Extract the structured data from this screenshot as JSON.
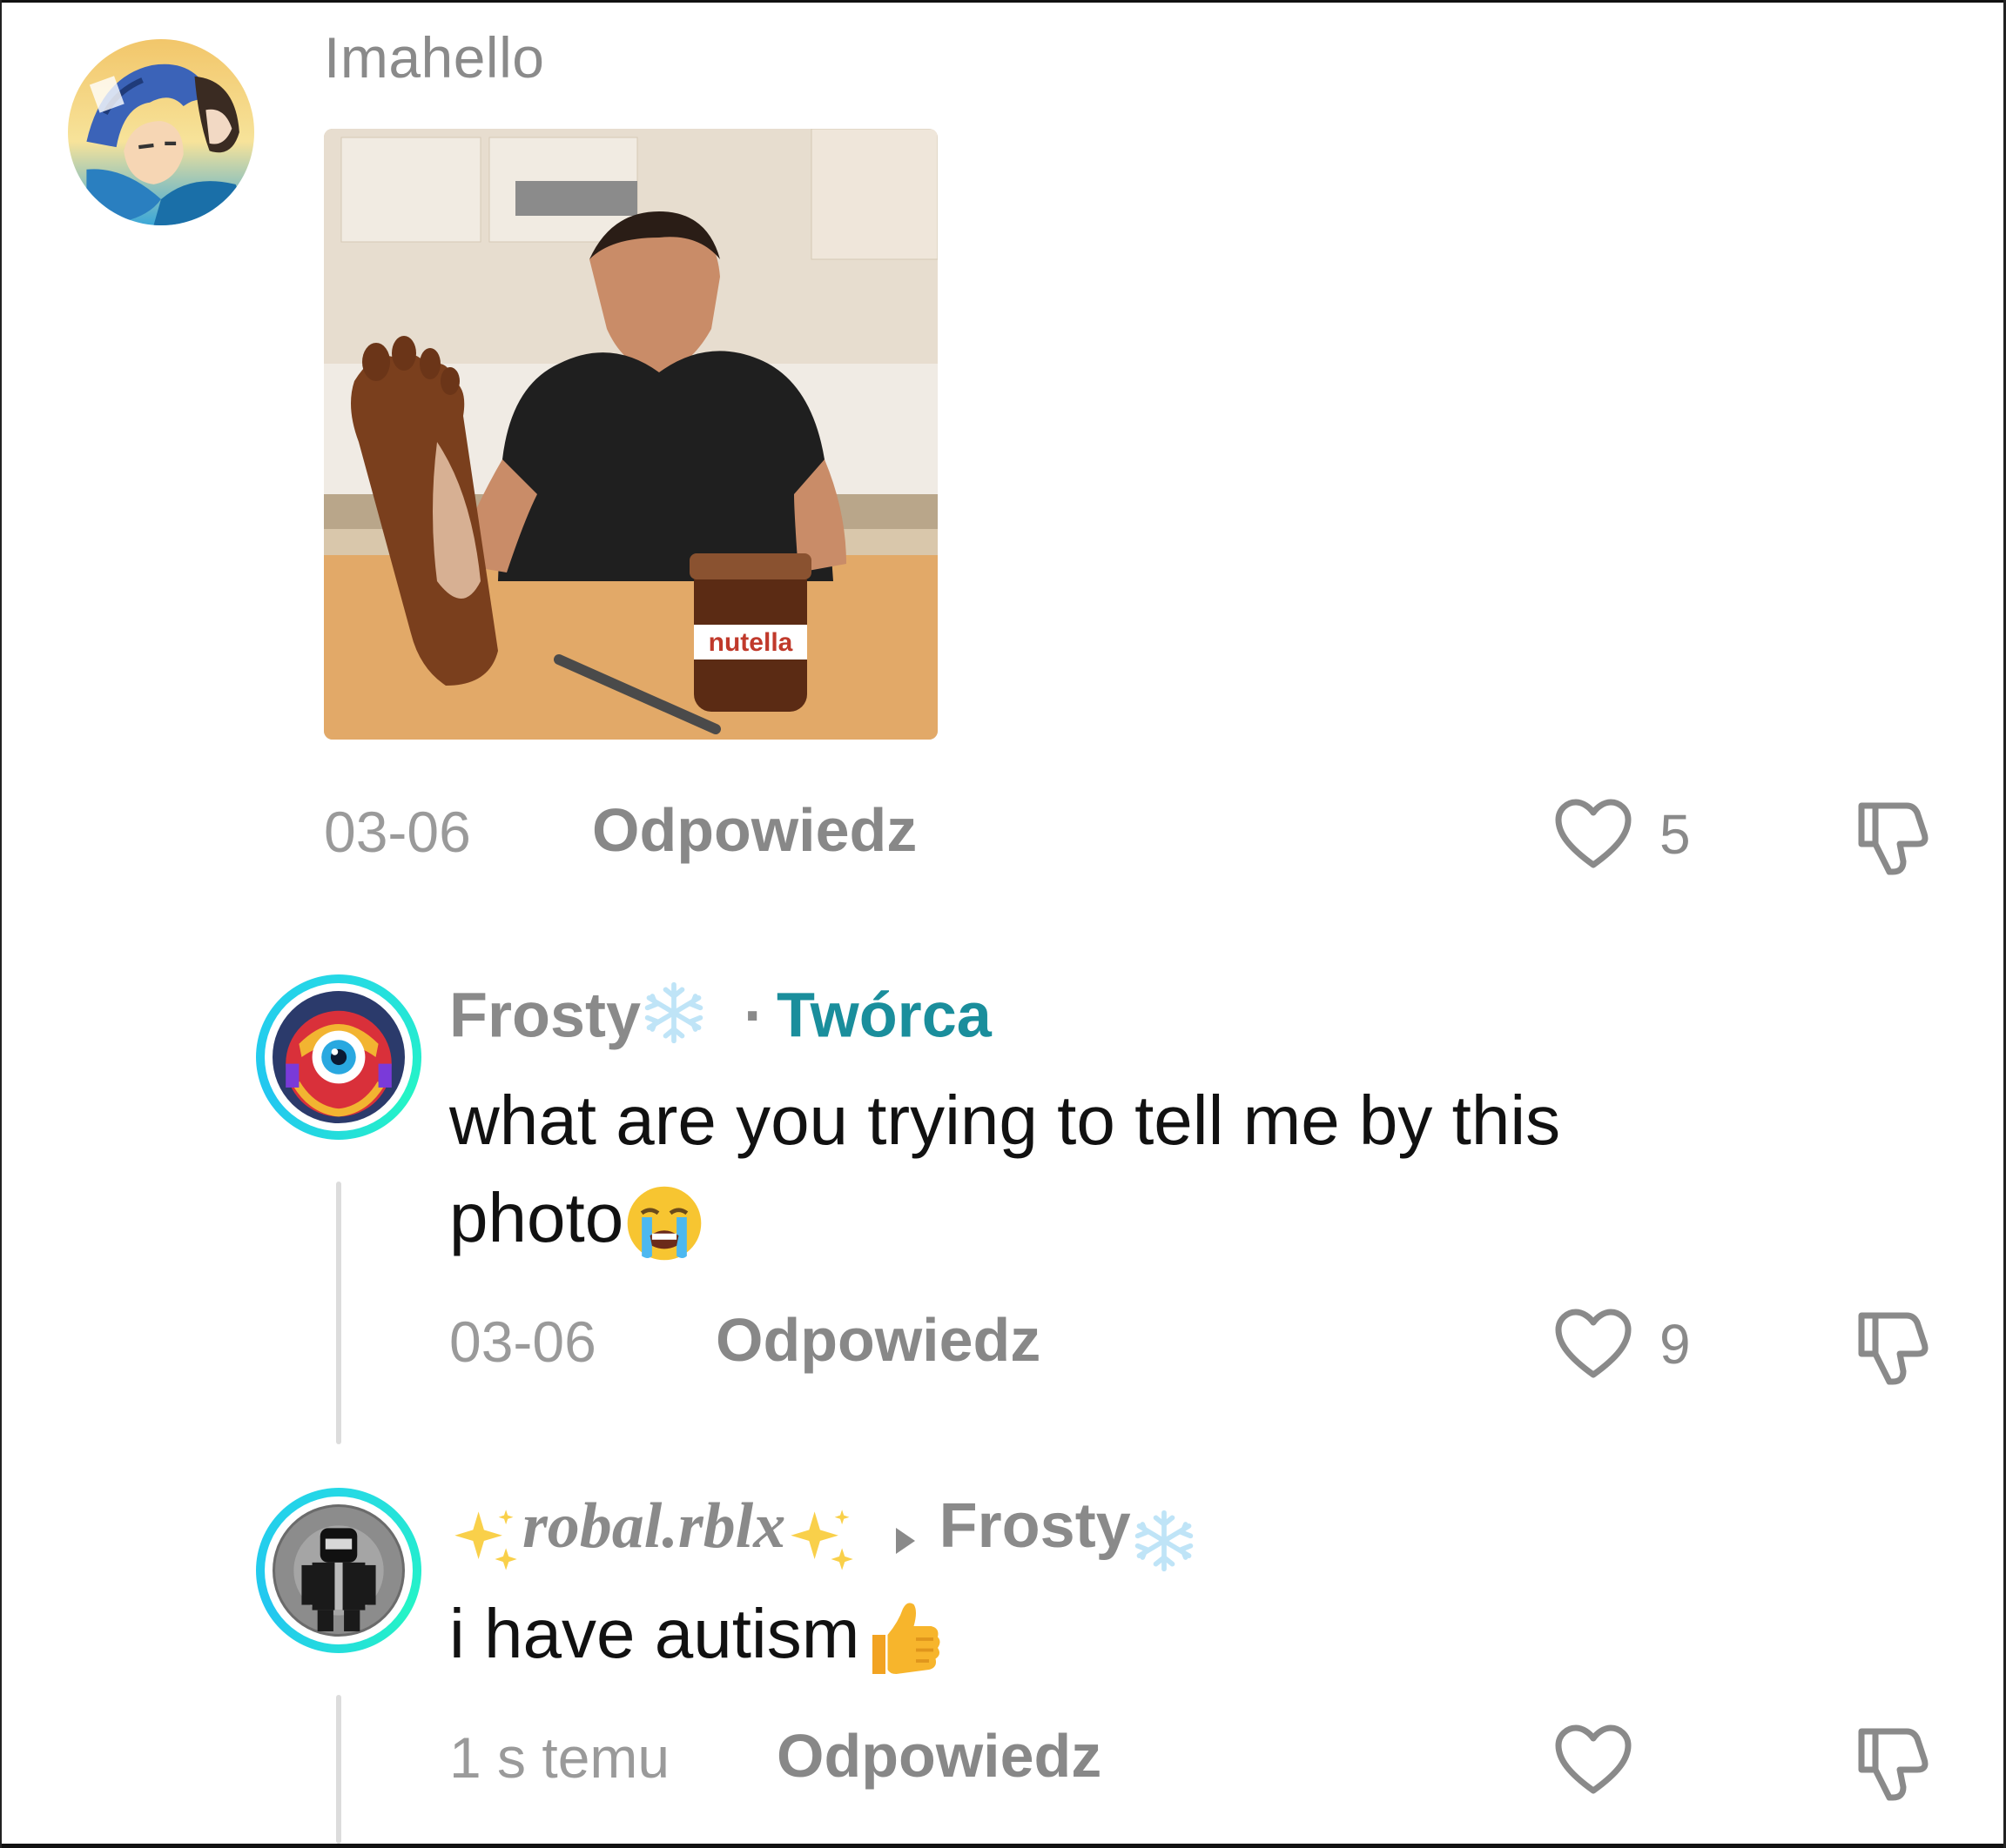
{
  "comments": [
    {
      "username": "Imahello",
      "image_alt": "",
      "date": "03-06",
      "reply_label": "Odpowiedz",
      "likes": "5",
      "avatar": "anime-character-avatar"
    },
    {
      "username": "Frosty",
      "username_suffix_icon": "snowflake-icon",
      "separator": "·",
      "role_tag": "Twórca",
      "text_line1": "what are you trying to tell me by this",
      "text_line2": "photo",
      "text_emoji": "loudly-crying-face",
      "date": "03-06",
      "reply_label": "Odpowiedz",
      "likes": "9",
      "avatar": "robot-avatar"
    },
    {
      "username": "robal.rblx",
      "username_decoration": "sparkles-icon",
      "reply_to": "Frosty",
      "reply_to_icon": "snowflake-icon",
      "text": "i have autism",
      "text_emoji": "thumbs-up",
      "date": "1 s temu",
      "reply_label": "Odpowiedz",
      "likes": "",
      "avatar": "roblox-character-avatar"
    }
  ],
  "colors": {
    "creator_tag": "#1a8e9c",
    "story_ring": "#25d8e6",
    "muted_text": "#8a8a8a"
  }
}
